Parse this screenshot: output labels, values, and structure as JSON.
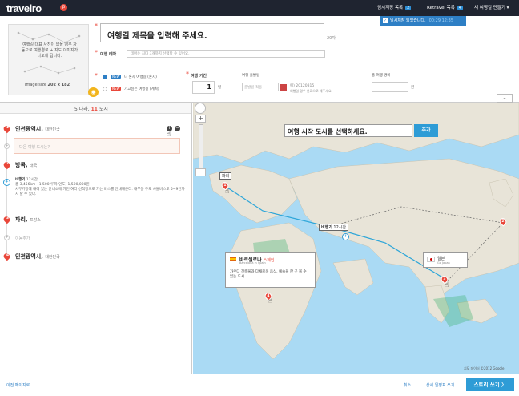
{
  "header": {
    "logo": "travelro",
    "logo_badge": "β",
    "nav": [
      {
        "label": "임시저장 목록",
        "count": "2"
      },
      {
        "label": "Retravel 목록",
        "count": "4"
      },
      {
        "label": "새 여행길 만들기 ▾",
        "count": ""
      }
    ]
  },
  "toast": {
    "text": "임시저장 되었습니다.",
    "time": "00:29 12:35"
  },
  "photo": {
    "guide": "여행길 대표 사진이 없을 경우 자동으로 여행경로 + 지도 이미지가 나오게 됩니다.",
    "size_label": "Image size",
    "size_value": "202 x 182"
  },
  "form": {
    "title_placeholder": "여행길 제목을 입력해 주세요.",
    "title_counter": "20자",
    "theme_label": "여행 테마",
    "theme_hint": "테마는 최대 3개까지 선택할 수 있어요.",
    "types": [
      {
        "tag": "NEW",
        "label": "나 혼자 여행길 (혼자)",
        "tag_color": "#2e7fc5",
        "selected": true
      },
      {
        "tag": "NEW",
        "label": "가고싶은 여행길 (계획)",
        "tag_color": "#e9473a",
        "selected": false
      }
    ],
    "period_label": "여행 기간",
    "period_value": "1",
    "period_unit": "일",
    "start_label": "여행 출발일",
    "start_placeholder": "출발일 적용",
    "start_example": "예) 20120815",
    "start_note": "여행일 경우 완료으로 해주세요",
    "cost_label": "총 여행 경비",
    "cost_unit": "원"
  },
  "collapse_icon": "︿",
  "route": {
    "summary_prefix": "5 나라,",
    "summary_count": "11",
    "summary_suffix": "도시",
    "stops": [
      {
        "num": "1",
        "city": "인천광역시",
        "country": "대한민국"
      },
      {
        "num": "2",
        "city": "방콕",
        "country": "태국"
      },
      {
        "num": "3",
        "city": "파리",
        "country": "프랑스"
      },
      {
        "num": "4",
        "city": "인천광역시",
        "country": "대한민국"
      }
    ],
    "city_input_placeholder": "다음 여행 도시는?",
    "transport_title": "비행기",
    "transport_time": "12시간",
    "transport_stats": "총 3,456km  ·  1,500 루피(인도)  1,500,000원",
    "transport_desc": "사무기장에 내에 있는 안내소에 가면 여러 선착장으로 가는 버스를 안내해준다. 대부분 주로 사들버스로 5~9인까지 탈 수 있다.",
    "move_label": "이동추가"
  },
  "map": {
    "search_text": "여행 시작 도시를 선택하세요.",
    "add_button": "추가",
    "labels": {
      "paris": "파리",
      "flight": "비행기",
      "flight_time": "12시간"
    },
    "pins": [
      "1",
      "2",
      "3",
      "4"
    ],
    "tip": {
      "city": "바르셀로나",
      "country": "스페인",
      "sub": "Barcelona in Spain",
      "desc": "가우디 건축물과 다채로운 음식, 예술을 한 곳 볼 수 있는 도시"
    },
    "japan": {
      "name": "일본",
      "sub": "Go Japan"
    },
    "copyright": "지도 데이터 ©2012 Google"
  },
  "footer": {
    "prev": "이전 페이지로",
    "cancel": "취소",
    "detail": "상세 일정표 쓰기",
    "story": "스토리 쓰기",
    "story_arrow": "〉"
  }
}
